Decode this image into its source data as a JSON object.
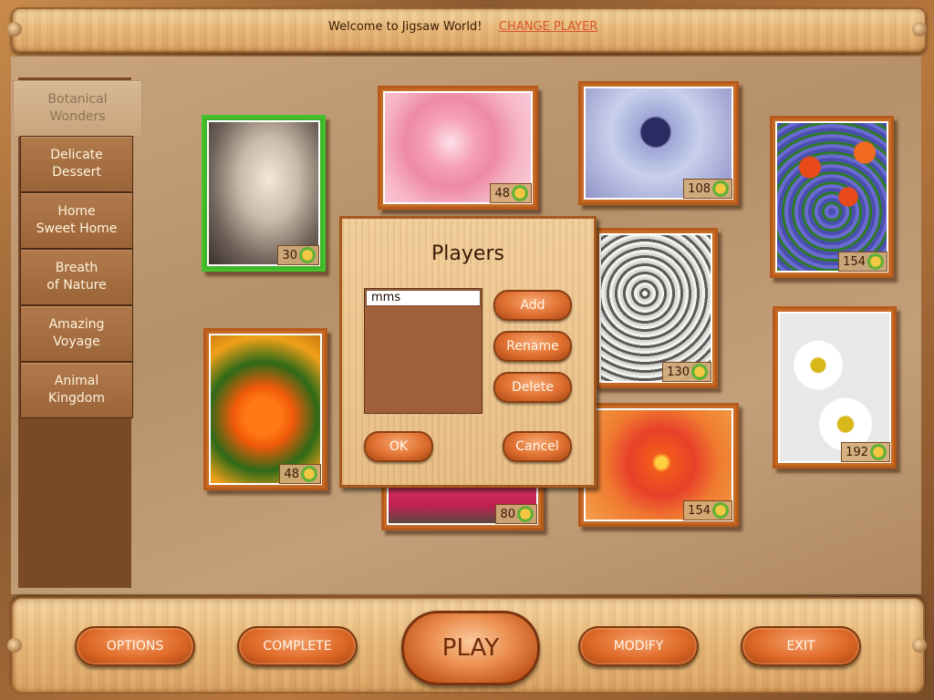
{
  "header": {
    "welcome_text": "Welcome to Jigsaw World!",
    "change_player_label": "CHANGE PLAYER"
  },
  "sidebar": {
    "items": [
      {
        "label": "Botanical\nWonders",
        "active": true
      },
      {
        "label": "Delicate\nDessert",
        "active": false
      },
      {
        "label": "Home\nSweet Home",
        "active": false
      },
      {
        "label": "Breath\nof Nature",
        "active": false
      },
      {
        "label": "Amazing\nVoyage",
        "active": false
      },
      {
        "label": "Animal\nKingdom",
        "active": false
      }
    ]
  },
  "puzzles": [
    {
      "name": "candles",
      "pieces": "30",
      "selected": true
    },
    {
      "name": "pink-rose",
      "pieces": "48"
    },
    {
      "name": "eryngium",
      "pieces": "108"
    },
    {
      "name": "tulips",
      "pieces": "154"
    },
    {
      "name": "gypsophila",
      "pieces": "130"
    },
    {
      "name": "orange-rose",
      "pieces": "48"
    },
    {
      "name": "daisies",
      "pieces": "192"
    },
    {
      "name": "waterdrop",
      "pieces": "80"
    },
    {
      "name": "dahlia",
      "pieces": "154"
    }
  ],
  "dialog": {
    "title": "Players",
    "players": [
      "mms"
    ],
    "add_label": "Add",
    "rename_label": "Rename",
    "delete_label": "Delete",
    "ok_label": "OK",
    "cancel_label": "Cancel"
  },
  "bottom": {
    "options_label": "OPTIONS",
    "complete_label": "COMPLETE",
    "play_label": "PLAY",
    "modify_label": "MODIFY",
    "exit_label": "EXIT"
  },
  "colors": {
    "accent": "#e06a28",
    "link": "#d8562a",
    "selected_border": "#44c22c"
  }
}
